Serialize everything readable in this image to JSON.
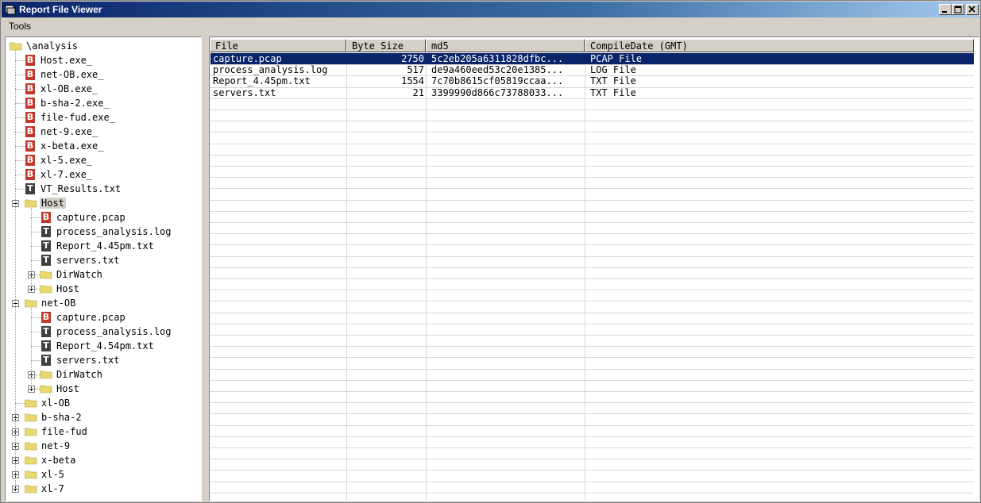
{
  "window": {
    "title": "Report File Viewer"
  },
  "menu": {
    "items": [
      "Tools"
    ]
  },
  "tree": {
    "root": "\\analysis",
    "root_files": [
      {
        "name": "Host.exe_",
        "type": "B"
      },
      {
        "name": "net-OB.exe_",
        "type": "B"
      },
      {
        "name": "xl-OB.exe_",
        "type": "B"
      },
      {
        "name": "b-sha-2.exe_",
        "type": "B"
      },
      {
        "name": "file-fud.exe_",
        "type": "B"
      },
      {
        "name": "net-9.exe_",
        "type": "B"
      },
      {
        "name": "x-beta.exe_",
        "type": "B"
      },
      {
        "name": "xl-5.exe_",
        "type": "B"
      },
      {
        "name": "xl-7.exe_",
        "type": "B"
      },
      {
        "name": "VT_Results.txt",
        "type": "T"
      }
    ],
    "host_folder": {
      "name": "Host",
      "files": [
        {
          "name": "capture.pcap",
          "type": "B"
        },
        {
          "name": "process_analysis.log",
          "type": "T"
        },
        {
          "name": "Report_4.45pm.txt",
          "type": "T"
        },
        {
          "name": "servers.txt",
          "type": "T"
        }
      ],
      "subfolders": [
        "DirWatch",
        "Host"
      ]
    },
    "netob_folder": {
      "name": "net-OB",
      "files": [
        {
          "name": "capture.pcap",
          "type": "B"
        },
        {
          "name": "process_analysis.log",
          "type": "T"
        },
        {
          "name": "Report_4.54pm.txt",
          "type": "T"
        },
        {
          "name": "servers.txt",
          "type": "T"
        }
      ],
      "subfolders": [
        "DirWatch",
        "Host"
      ]
    },
    "other_folders": [
      "xl-OB",
      "b-sha-2",
      "file-fud",
      "net-9",
      "x-beta",
      "xl-5",
      "xl-7"
    ]
  },
  "list": {
    "columns": [
      "File",
      "Byte Size",
      "md5",
      "CompileDate (GMT)"
    ],
    "rows": [
      {
        "file": "capture.pcap",
        "size": "2750",
        "md5": "5c2eb205a6311828dfbc...",
        "date": "PCAP File",
        "selected": true
      },
      {
        "file": "process_analysis.log",
        "size": "517",
        "md5": "de9a460eed53c20e1385...",
        "date": "LOG File",
        "selected": false
      },
      {
        "file": "Report_4.45pm.txt",
        "size": "1554",
        "md5": "7c70b8615cf05819ccaa...",
        "date": "TXT File",
        "selected": false
      },
      {
        "file": "servers.txt",
        "size": "21",
        "md5": "3399990d866c73788033...",
        "date": "TXT File",
        "selected": false
      }
    ]
  },
  "colors": {
    "selection": "#0a246a",
    "b_icon": "#c0392b",
    "t_icon": "#404040",
    "folder": "#e8d870"
  }
}
